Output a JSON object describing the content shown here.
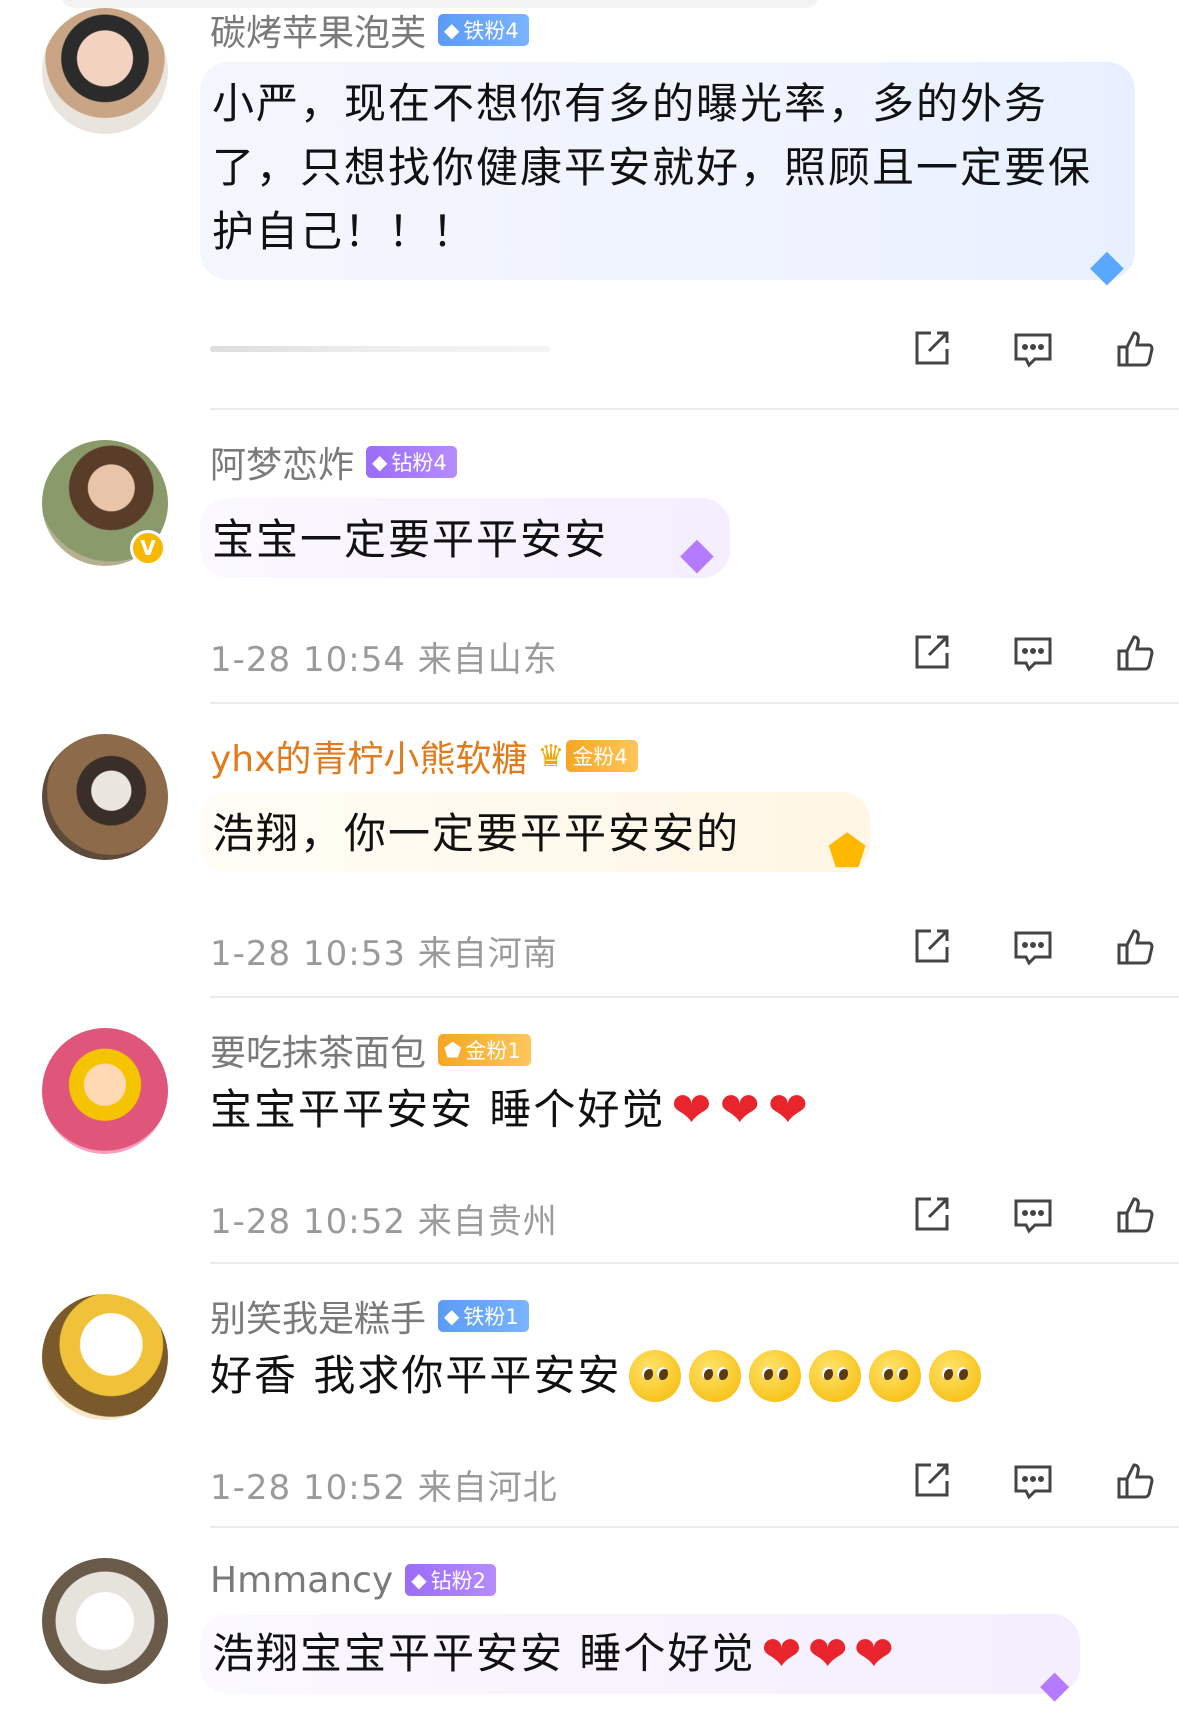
{
  "comments": [
    {
      "username": "碳烤苹果泡芙",
      "badge": "铁粉4",
      "badge_type": "iron",
      "content": "小严，现在不想你有多的曝光率，多的外务了，只想找你健康平安就好，照顾且一定要保护自己！！！",
      "time": "",
      "location": ""
    },
    {
      "username": "阿梦恋炸",
      "badge": "钻粉4",
      "badge_type": "diamond",
      "content": "宝宝一定要平平安安",
      "time": "1-28 10:54",
      "location": "来自山东",
      "verified": "V"
    },
    {
      "username": "yhx的青柠小熊软糖",
      "badge": "金粉4",
      "badge_type": "gold",
      "content": "浩翔，你一定要平平安安的",
      "time": "1-28 10:53",
      "location": "来自河南"
    },
    {
      "username": "要吃抹茶面包",
      "badge": "金粉1",
      "badge_type": "gold",
      "content": "宝宝平平安安 睡个好觉",
      "emoji": "❤",
      "time": "1-28 10:52",
      "location": "来自贵州"
    },
    {
      "username": "别笑我是糕手",
      "badge": "铁粉1",
      "badge_type": "iron",
      "content": "好香 我求你平平安安",
      "time": "1-28 10:52",
      "location": "来自河北"
    },
    {
      "username": "Hmmancy",
      "badge": "钻粉2",
      "badge_type": "diamond",
      "content": "浩翔宝宝平平安安 睡个好觉",
      "emoji": "❤"
    }
  ],
  "icons": {
    "share": "share-icon",
    "reply": "comment-icon",
    "like": "thumbs-up-icon",
    "gem": "gem-icon"
  },
  "colors": {
    "gold_username": "#e07a1b",
    "iron_badge": "#5b9bf5",
    "diamond_badge": "#9b6cf5",
    "gold_badge": "#f6a623"
  }
}
